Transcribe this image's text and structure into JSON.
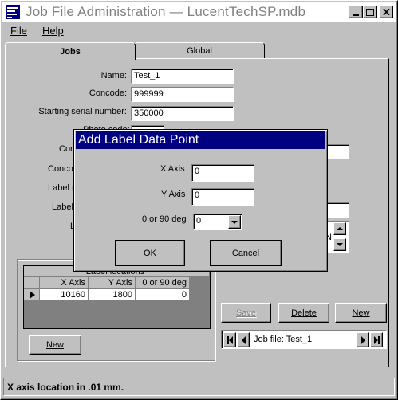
{
  "window": {
    "title": "Job File Administration — LucentTechSP.mdb"
  },
  "menu": {
    "file": "File",
    "help": "Help"
  },
  "tabs": {
    "jobs": "Jobs",
    "global": "Global"
  },
  "form": {
    "name_label": "Name:",
    "name_value": "Test_1",
    "concode_label": "Concode:",
    "concode_value": "999999",
    "serial_label": "Starting serial number:",
    "serial_value": "350000",
    "partial_labels": [
      "Photo code:",
      "Con",
      "Conco",
      "Label t",
      "Label",
      "L"
    ]
  },
  "grid": {
    "title": "Label locations",
    "columns": [
      "X Axis",
      "Y Axis",
      "0 or 90 deg"
    ],
    "rows": [
      {
        "x": "10160",
        "y": "1800",
        "deg": "0"
      }
    ]
  },
  "buttons": {
    "new_left": "New",
    "save": "Save",
    "delete": "Delete",
    "new_right": "New"
  },
  "navigator": {
    "label": "Job file: Test_1"
  },
  "status": {
    "text": "X axis location in .01 mm."
  },
  "dialog": {
    "title": "Add Label Data Point",
    "x_label": "X Axis",
    "x_value": "0",
    "y_label": "Y Axis",
    "y_value": "0",
    "deg_label": "0 or 90 deg",
    "deg_value": "0",
    "ok": "OK",
    "cancel": "Cancel"
  },
  "colors": {
    "titlebar": "#000080",
    "face": "#c0c0c0"
  }
}
